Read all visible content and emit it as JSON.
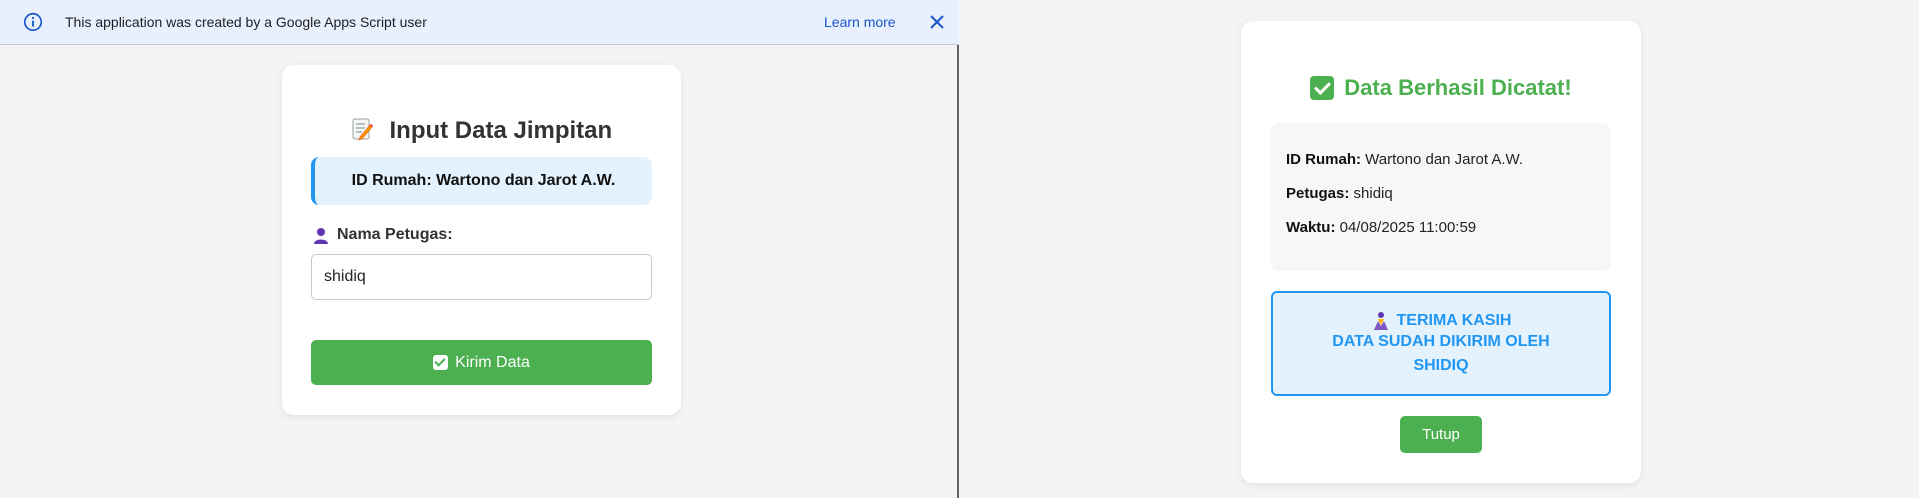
{
  "banner": {
    "message": "This application was created by a Google Apps Script user",
    "learn_more": "Learn more",
    "info_icon": "info-icon",
    "close_icon": "close-icon"
  },
  "form": {
    "title": "Input Data Jimpitan",
    "title_icon": "memo-icon",
    "id_rumah": "ID Rumah: Wartono dan Jarot A.W.",
    "petugas_label": "Nama Petugas:",
    "petugas_icon": "person-icon",
    "petugas_value": "shidiq",
    "submit_label": "Kirim Data",
    "accent_color": "#4caf50",
    "info_color": "#2196f3"
  },
  "result": {
    "title": "Data Berhasil Dicatat!",
    "title_icon": "check-icon",
    "id_rumah_label": "ID Rumah:",
    "id_rumah_value": "Wartono dan Jarot A.W.",
    "petugas_label": "Petugas:",
    "petugas_value": "shidiq",
    "waktu_label": "Waktu:",
    "waktu_value": "04/08/2025 11:00:59",
    "thanks_line1": "TERIMA KASIH",
    "thanks_line2": "DATA SUDAH DIKIRIM OLEH",
    "thanks_name": "SHIDIQ",
    "thanks_icon": "praying-hands-icon",
    "close_label": "Tutup"
  }
}
